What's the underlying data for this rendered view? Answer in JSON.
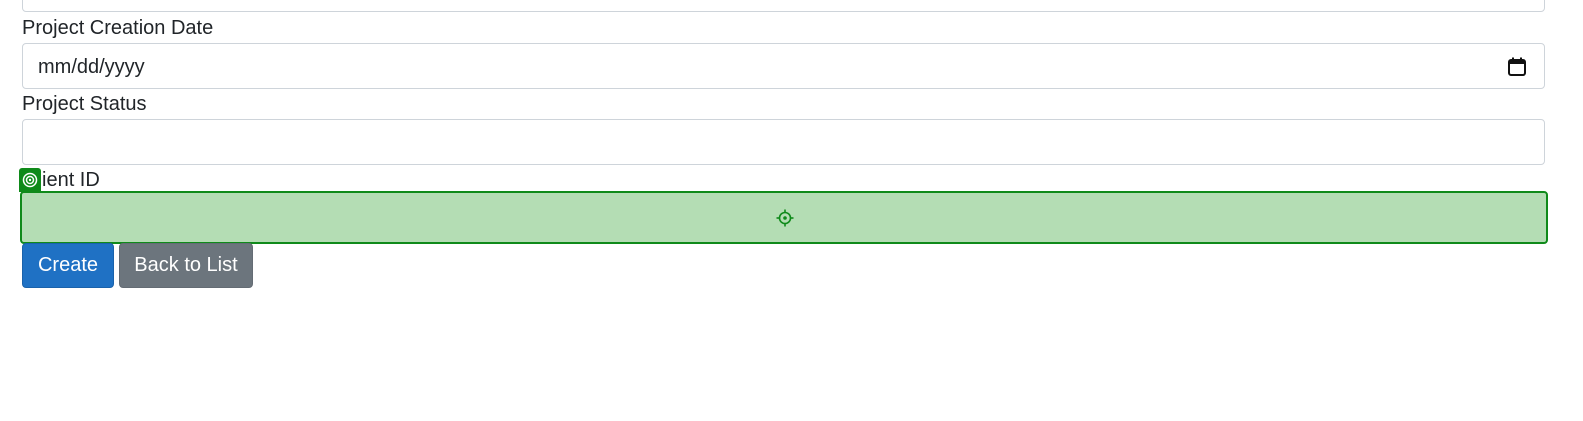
{
  "form": {
    "creation_date": {
      "label": "Project Creation Date",
      "placeholder": "mm/dd/yyyy",
      "icon": "calendar-icon"
    },
    "status": {
      "label": "Project Status",
      "value": ""
    },
    "client_id": {
      "label": "ient ID",
      "value": "",
      "icon": "crosshair-icon",
      "marker_icon": "target-icon",
      "highlight_color": "#b4ddb4",
      "border_color": "#0f8a1a"
    }
  },
  "actions": {
    "create_label": "Create",
    "back_label": "Back to List",
    "create_color": "#1f71c4",
    "back_color": "#6c757d"
  }
}
